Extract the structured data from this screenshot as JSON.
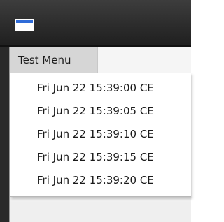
{
  "window": {
    "icon": "window-icon"
  },
  "menubar": {
    "menu_title": "Test Menu"
  },
  "menu": {
    "items": [
      "Fri Jun 22 15:39:00 CE",
      "Fri Jun 22 15:39:05 CE",
      "Fri Jun 22 15:39:10 CE",
      "Fri Jun 22 15:39:15 CE",
      "Fri Jun 22 15:39:20 CE"
    ]
  },
  "colors": {
    "titlebar": "#2a2a2a",
    "menu_title_highlight": "#d6d6d6",
    "icon_blue": "#2f6bd8"
  }
}
